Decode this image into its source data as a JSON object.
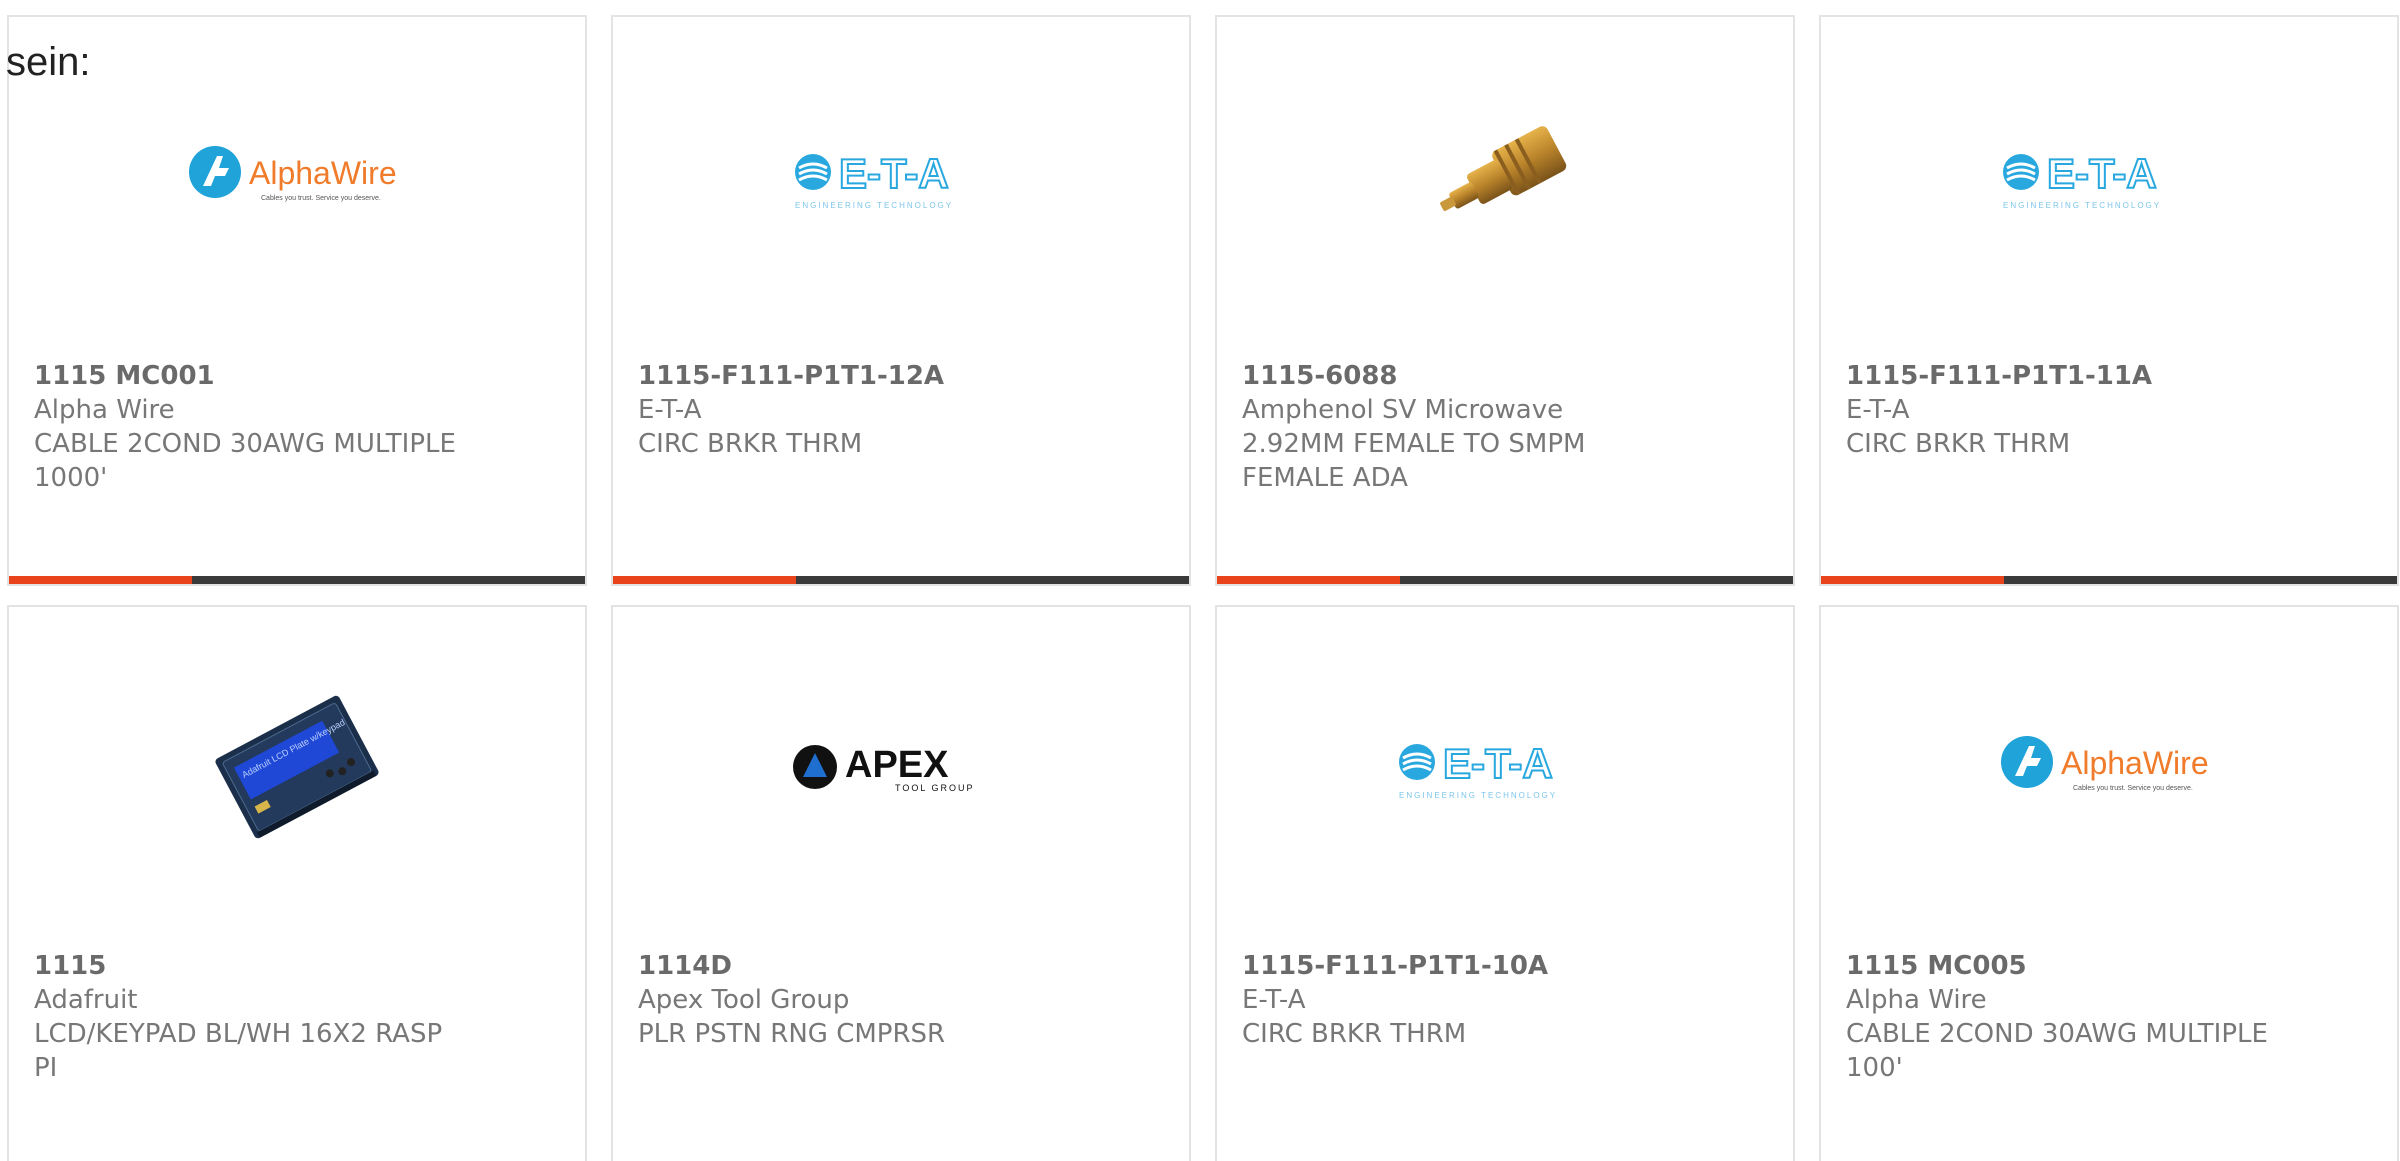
{
  "intro_text": "sein:",
  "colors": {
    "accent": "#e8431a",
    "bar": "#3a3a3a",
    "card_border": "#e3e3e3",
    "text": "#777777"
  },
  "products": [
    {
      "part_number": "1115 MC001",
      "manufacturer": "Alpha Wire",
      "description": "CABLE 2COND 30AWG MULTIPLE 1000'",
      "image": "alphawire-logo",
      "logo_text": "AlphaWire",
      "logo_tagline": "Cables you trust. Service you deserve."
    },
    {
      "part_number": "1115-F111-P1T1-12A",
      "manufacturer": "E-T-A",
      "description": "CIRC BRKR THRM",
      "image": "eta-logo",
      "logo_text": "E-T-A",
      "logo_tagline": "ENGINEERING TECHNOLOGY"
    },
    {
      "part_number": "1115-6088",
      "manufacturer": "Amphenol SV Microwave",
      "description": "2.92MM FEMALE TO SMPM FEMALE ADA",
      "image": "rf-adapter-photo",
      "logo_text": "",
      "logo_tagline": ""
    },
    {
      "part_number": "1115-F111-P1T1-11A",
      "manufacturer": "E-T-A",
      "description": "CIRC BRKR THRM",
      "image": "eta-logo",
      "logo_text": "E-T-A",
      "logo_tagline": "ENGINEERING TECHNOLOGY"
    },
    {
      "part_number": "1115",
      "manufacturer": "Adafruit",
      "description": "LCD/KEYPAD BL/WH 16X2 RASP PI",
      "image": "lcd-keypad-photo",
      "logo_text": "",
      "logo_tagline": "",
      "lcd_text": "Adafruit LCD Plate w/keypad"
    },
    {
      "part_number": "1114D",
      "manufacturer": "Apex Tool Group",
      "description": "PLR PSTN RNG CMPRSR",
      "image": "apex-logo",
      "logo_text": "APEX",
      "logo_tagline": "TOOL GROUP"
    },
    {
      "part_number": "1115-F111-P1T1-10A",
      "manufacturer": "E-T-A",
      "description": "CIRC BRKR THRM",
      "image": "eta-logo",
      "logo_text": "E-T-A",
      "logo_tagline": "ENGINEERING TECHNOLOGY"
    },
    {
      "part_number": "1115 MC005",
      "manufacturer": "Alpha Wire",
      "description": "CABLE 2COND 30AWG MULTIPLE 100'",
      "image": "alphawire-logo",
      "logo_text": "AlphaWire",
      "logo_tagline": "Cables you trust. Service you deserve."
    }
  ]
}
